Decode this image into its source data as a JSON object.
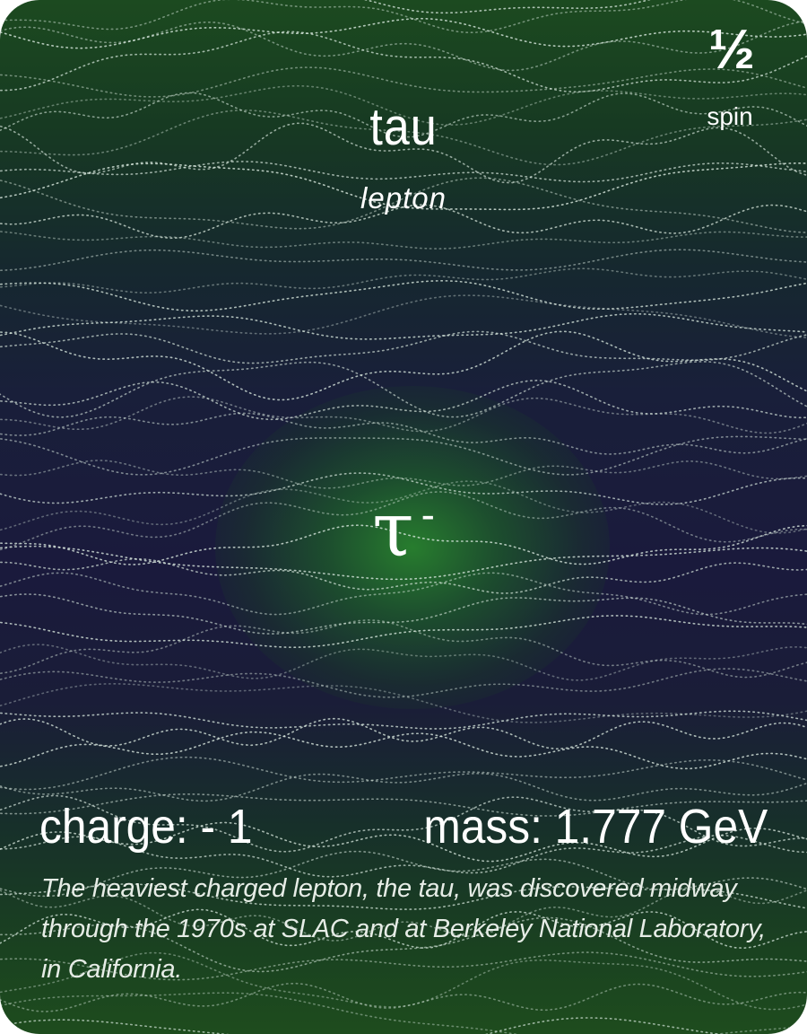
{
  "particle": {
    "name": "tau",
    "family": "lepton",
    "symbol": "τ",
    "symbol_superscript": "-",
    "spin_value": "½",
    "spin_label": "spin",
    "charge": "charge: - 1",
    "mass": "mass: 1.777 GeV",
    "description": "The heaviest charged lepton, the tau, was discovered midway through the 1970s at SLAC and at Berkeley National Laboratory, in California."
  },
  "colors": {
    "background_top": "#1c4a20",
    "background_middle": "#1a1a3c",
    "background_bottom": "#1e4c1e",
    "glow": "#28822d",
    "text": "#ffffff"
  }
}
